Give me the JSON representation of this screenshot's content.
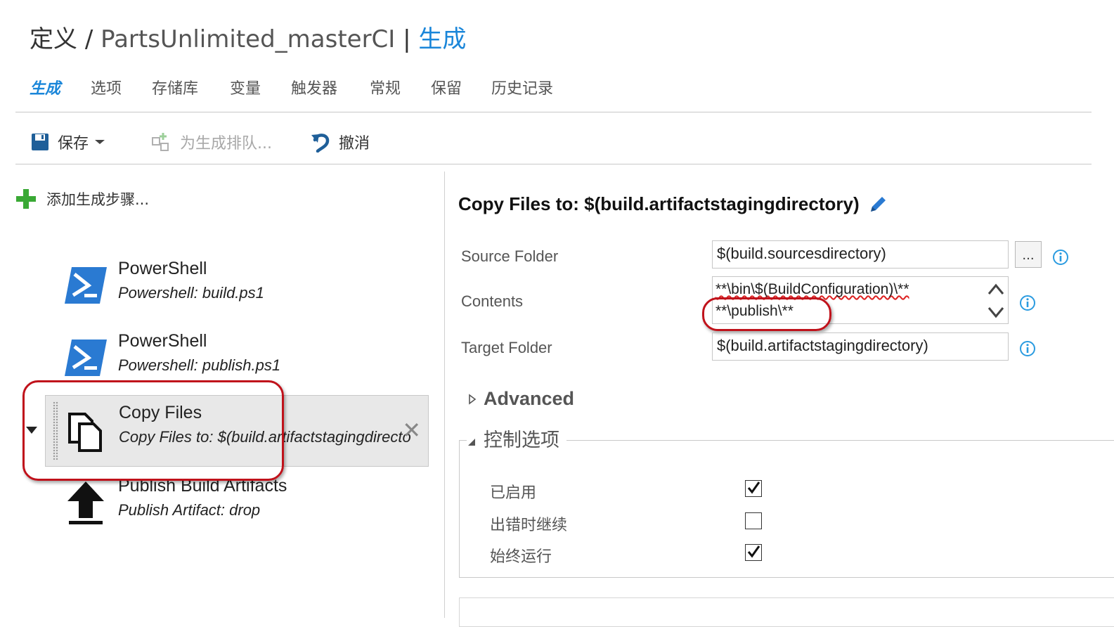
{
  "header": {
    "crumb_root": "定义",
    "crumb_sep": "/",
    "definition_name": "PartsUnlimited_masterCI",
    "pipe": "|",
    "current": "生成"
  },
  "tabs": [
    {
      "label": "生成",
      "active": true
    },
    {
      "label": "选项"
    },
    {
      "label": "存储库"
    },
    {
      "label": "变量"
    },
    {
      "label": "触发器"
    },
    {
      "label": "常规"
    },
    {
      "label": "保留"
    },
    {
      "label": "历史记录"
    }
  ],
  "toolbar": {
    "save_label": "保存",
    "queue_label": "为生成排队...",
    "undo_label": "撤消"
  },
  "left": {
    "add_step_label": "添加生成步骤...",
    "steps": [
      {
        "name": "PowerShell",
        "desc": "Powershell: build.ps1",
        "icon": "powershell-icon"
      },
      {
        "name": "PowerShell",
        "desc": "Powershell: publish.ps1",
        "icon": "powershell-icon"
      },
      {
        "name": "Copy Files",
        "desc": "Copy Files to: $(build.artifactstagingdirecto",
        "icon": "copy-files-icon",
        "selected": true
      },
      {
        "name": "Publish Build Artifacts",
        "desc": "Publish Artifact: drop",
        "icon": "upload-icon"
      }
    ]
  },
  "detail": {
    "title": "Copy Files to: $(build.artifactstagingdirectory)",
    "source_folder_label": "Source Folder",
    "source_folder_value": "$(build.sourcesdirectory)",
    "browse_label": "...",
    "contents_label": "Contents",
    "contents_line1": "**\\bin\\$(BuildConfiguration)\\**",
    "contents_line2": "**\\publish\\**",
    "target_folder_label": "Target Folder",
    "target_folder_value": "$(build.artifactstagingdirectory)",
    "advanced_label": "Advanced",
    "control_label": "控制选项",
    "options": [
      {
        "label": "已启用",
        "checked": true
      },
      {
        "label": "出错时继续",
        "checked": false
      },
      {
        "label": "始终运行",
        "checked": true
      }
    ]
  },
  "colors": {
    "accent": "#1a86d9",
    "highlight_ring": "#c0121b",
    "add_icon": "#3aa935",
    "selected_bg": "#e8e8e8"
  }
}
